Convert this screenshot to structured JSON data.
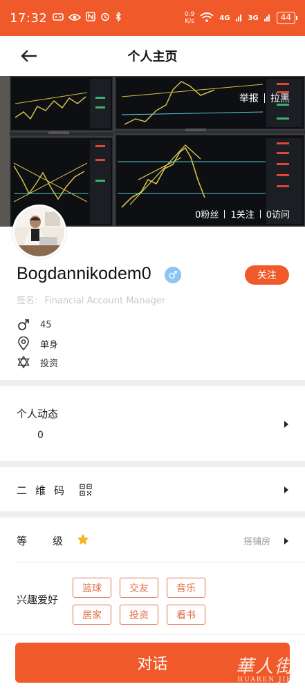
{
  "status_bar": {
    "time": "17:32",
    "net_speed_value": "0.9",
    "net_speed_unit": "K/s",
    "signal_1": "4G",
    "signal_2": "3G",
    "battery": "44"
  },
  "nav": {
    "title": "个人主页"
  },
  "banner": {
    "report_label": "举报",
    "block_label": "拉黑",
    "fans": "0粉丝",
    "following": "1关注",
    "visits": "0访问"
  },
  "profile": {
    "username": "Bogdannikodem0",
    "gender_symbol": "♂",
    "follow_label": "关注",
    "signature_label": "签名:",
    "signature": "Financial Account Manager",
    "age": "45",
    "marital_status": "单身",
    "interest_main": "投资"
  },
  "sections": {
    "moments_label": "个人动态",
    "moments_count": "0",
    "qr_label": "二维码",
    "level_label_1": "等",
    "level_label_2": "级",
    "level_value": "搭铺房",
    "hobbies_label": "兴趣爱好",
    "hobbies": [
      "篮球",
      "交友",
      "音乐",
      "居家",
      "投资",
      "看书"
    ]
  },
  "bottom": {
    "chat_label": "对话",
    "watermark_main": "華人街",
    "watermark_sub": "HUAREN JIE"
  },
  "colors": {
    "accent": "#f05a2a",
    "tag_border": "#e0704a",
    "gender_badge": "#8cc4f2",
    "star": "#f5b427"
  }
}
